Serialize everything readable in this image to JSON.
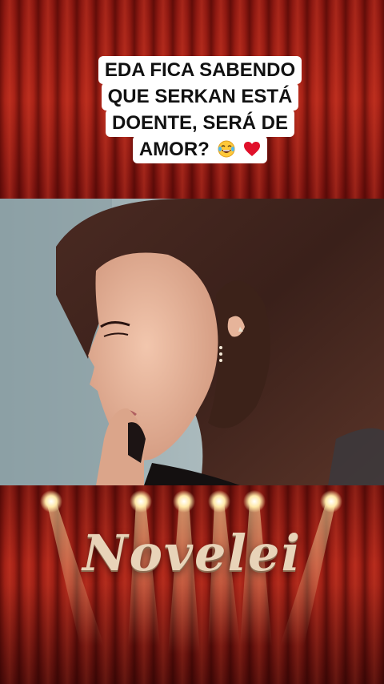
{
  "caption": {
    "lines": [
      "EDA FICA SABENDO",
      "QUE SERKAN ESTÁ",
      "DOENTE, SERÁ DE",
      "AMOR?"
    ],
    "emoji_1": "laughing-tears",
    "emoji_2": "red-heart"
  },
  "logo": {
    "text": "Novelei"
  },
  "colors": {
    "curtain": "#b3281a",
    "caption_bg": "#ffffff",
    "logo_text": "#e8d3b8",
    "heart": "#e0102a",
    "spotlight": "#ffe9a8"
  }
}
